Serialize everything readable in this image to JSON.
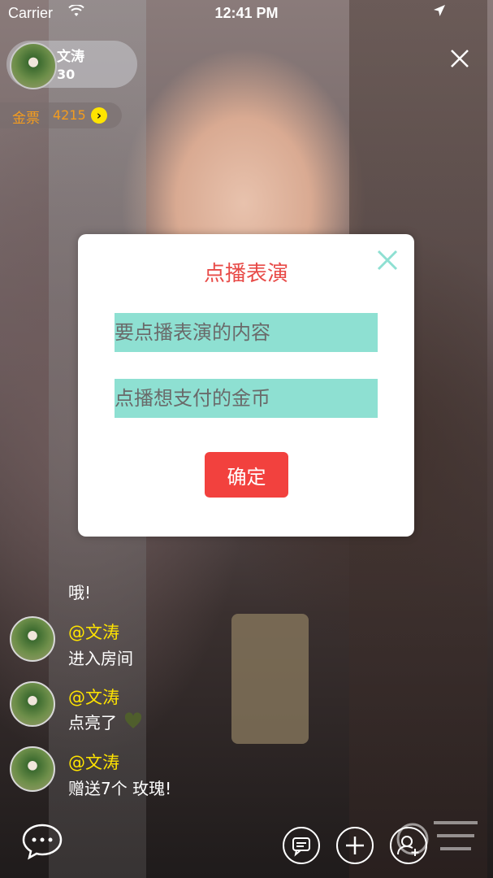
{
  "status_bar": {
    "carrier": "Carrier",
    "time": "12:41 PM"
  },
  "host": {
    "name": "文涛",
    "count": "30"
  },
  "coins": {
    "label": "金票",
    "value": "4215"
  },
  "modal": {
    "title": "点播表演",
    "content_placeholder": "要点播表演的内容",
    "coins_placeholder": "点播想支付的金币",
    "confirm_label": "确定"
  },
  "chat": {
    "plain_message": "哦!",
    "messages": [
      {
        "user": "@文涛",
        "text": "进入房间"
      },
      {
        "user": "@文涛",
        "text": "点亮了"
      },
      {
        "user": "@文涛",
        "text": "赠送7个 玫瑰!"
      }
    ]
  },
  "colors": {
    "accent": "#e84b48",
    "button": "#f2413e",
    "field": "#8ee0d2",
    "username": "#ffe400",
    "coins": "#f39c1f"
  },
  "icons": [
    "wifi-icon",
    "location-arrow-icon",
    "close-icon",
    "chevron-right-icon",
    "heart-icon",
    "chat-bubble-icon",
    "message-icon",
    "plus-icon",
    "add-friend-icon"
  ]
}
